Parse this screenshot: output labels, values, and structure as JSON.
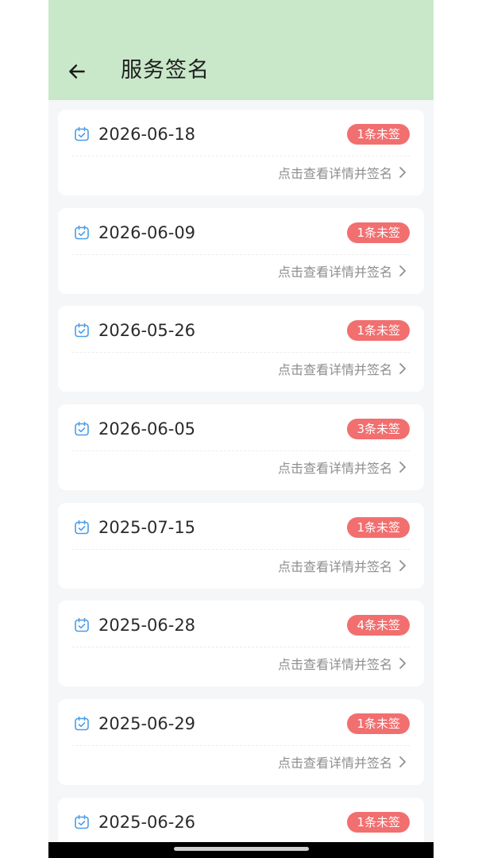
{
  "header": {
    "title": "服务签名",
    "back_icon": "arrow-left-icon",
    "background_color": "#c9e7c9"
  },
  "records": [
    {
      "date": "2026-06-18",
      "badge": "1条未签",
      "action": "点击查看详情并签名"
    },
    {
      "date": "2026-06-09",
      "badge": "1条未签",
      "action": "点击查看详情并签名"
    },
    {
      "date": "2026-05-26",
      "badge": "1条未签",
      "action": "点击查看详情并签名"
    },
    {
      "date": "2026-06-05",
      "badge": "3条未签",
      "action": "点击查看详情并签名"
    },
    {
      "date": "2025-07-15",
      "badge": "1条未签",
      "action": "点击查看详情并签名"
    },
    {
      "date": "2025-06-28",
      "badge": "4条未签",
      "action": "点击查看详情并签名"
    },
    {
      "date": "2025-06-29",
      "badge": "1条未签",
      "action": "点击查看详情并签名"
    },
    {
      "date": "2025-06-26",
      "badge": "1条未签",
      "action": "点击查看详情并签名"
    }
  ],
  "icons": {
    "calendar": "calendar-check-icon",
    "chevron": "chevron-right-icon"
  },
  "colors": {
    "badge": "#f26f6f",
    "calendar_icon": "#4a9de8"
  }
}
